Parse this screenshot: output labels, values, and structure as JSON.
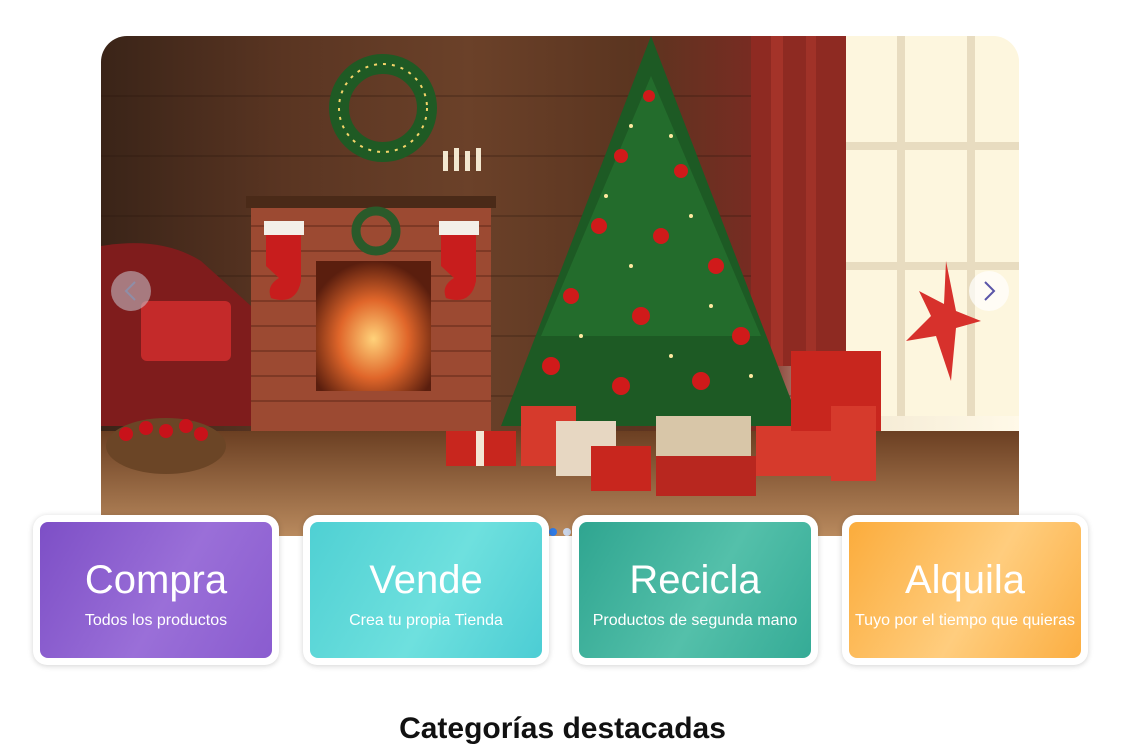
{
  "hero": {
    "image_alt": "Christmas living room with fireplace, decorated tree and gifts",
    "prev_icon": "chevron-left-icon",
    "next_icon": "chevron-right-icon",
    "slide_count": 3,
    "active_slide": 1
  },
  "cards": [
    {
      "title": "Compra",
      "subtitle": "Todos los productos",
      "color": "#8a5ccf"
    },
    {
      "title": "Vende",
      "subtitle": "Crea tu propia Tienda",
      "color": "#55d3d6"
    },
    {
      "title": "Recicla",
      "subtitle": "Productos de segunda mano",
      "color": "#3db19c"
    },
    {
      "title": "Alquila",
      "subtitle": "Tuyo por el tiempo que quieras",
      "color": "#fcb64e"
    }
  ],
  "section": {
    "title": "Categorías destacadas"
  },
  "colors": {
    "dot_active": "#2f7ae5",
    "dot_inactive": "#c9d4e8"
  }
}
